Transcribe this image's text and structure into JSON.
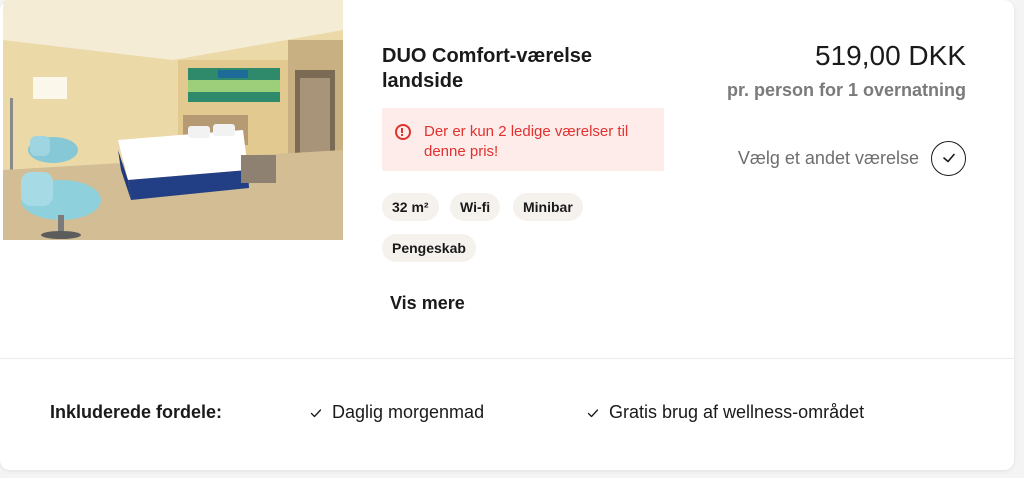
{
  "room": {
    "title": "DUO Comfort-værelse landside",
    "alert_text": "Der er kun 2 ledige værelser til denne pris!",
    "features": [
      "32 m²",
      "Wi-fi",
      "Minibar",
      "Pengeskab"
    ],
    "more_link": "Vis mere"
  },
  "pricing": {
    "price": "519,00 DKK",
    "per_person": "pr. person for 1 overnatning"
  },
  "selection": {
    "label": "Vælg et andet værelse",
    "icon": "check-circle-icon"
  },
  "benefits": {
    "label": "Inkluderede fordele:",
    "items": [
      "Daglig morgenmad",
      "Gratis brug af wellness-området"
    ]
  },
  "colors": {
    "alert_bg": "#fdecea",
    "alert_text": "#e0322f",
    "chip_bg": "#f5f2ee",
    "muted_text": "#7a7a7a"
  }
}
